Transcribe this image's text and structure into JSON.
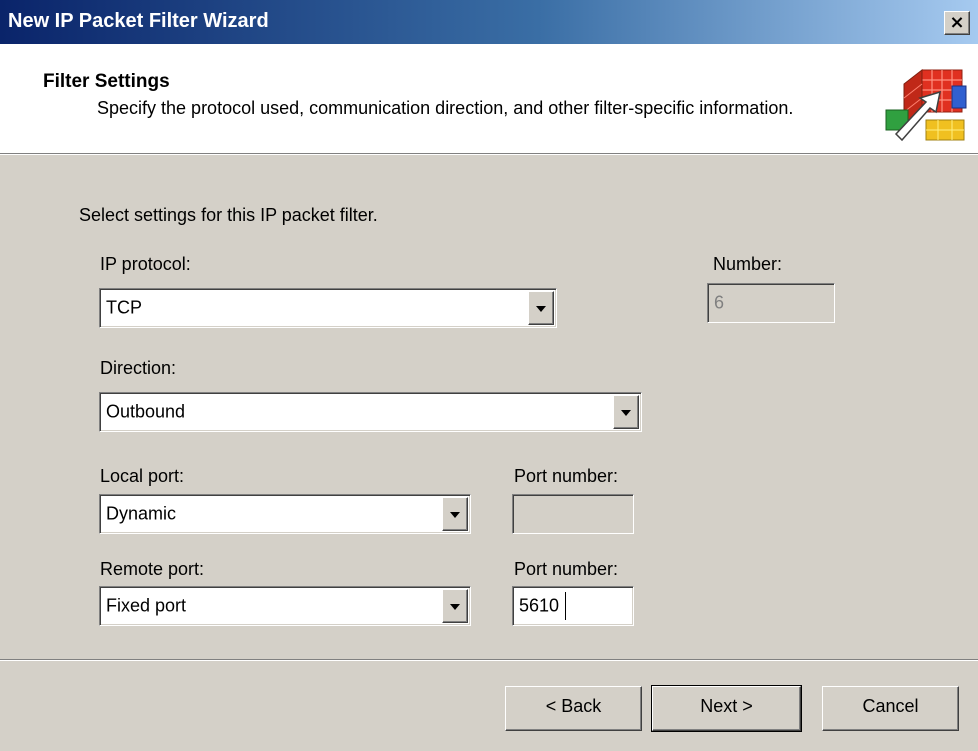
{
  "window": {
    "title": "New IP Packet Filter Wizard",
    "close_glyph": "×"
  },
  "header": {
    "title": "Filter Settings",
    "description": "Specify the protocol used, communication direction, and other filter-specific information.",
    "icon": "firewall-wizard-icon"
  },
  "body": {
    "intro": "Select settings for this IP packet filter.",
    "ip_protocol": {
      "label": "IP protocol:",
      "value": "TCP"
    },
    "number": {
      "label": "Number:",
      "value": "6"
    },
    "direction": {
      "label": "Direction:",
      "value": "Outbound"
    },
    "local_port": {
      "label": "Local port:",
      "value": "Dynamic"
    },
    "local_port_number": {
      "label": "Port number:",
      "value": ""
    },
    "remote_port": {
      "label": "Remote port:",
      "value": "Fixed port"
    },
    "remote_port_number": {
      "label": "Port number:",
      "value": "5610"
    }
  },
  "buttons": {
    "back": "< Back",
    "next": "Next >",
    "cancel": "Cancel"
  }
}
